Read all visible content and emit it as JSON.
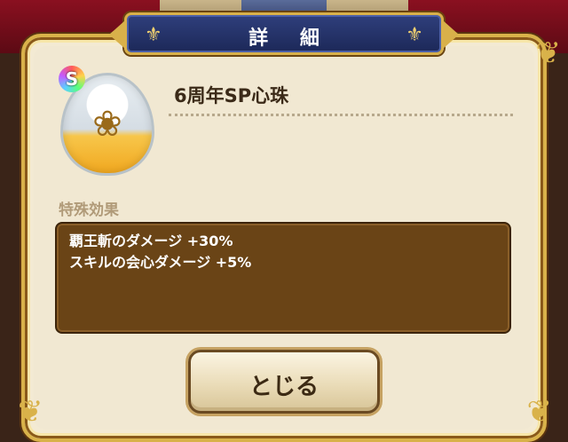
{
  "dialog": {
    "title": "詳 細"
  },
  "item": {
    "rank": "S",
    "name": "6周年SP心珠"
  },
  "special_effect": {
    "label": "特殊効果",
    "lines": [
      "覇王斬のダメージ +30%",
      "スキルの会心ダメージ +5%"
    ]
  },
  "buttons": {
    "close_label": "とじる"
  },
  "icons": {
    "fleur_left": "fleur-de-lis-icon",
    "fleur_right": "fleur-de-lis-icon",
    "laurel": "laurel-wreath-icon"
  },
  "colors": {
    "title_plate": "#1c2858",
    "frame_gold": "#d9b24a",
    "effects_box": "#6a4416"
  }
}
